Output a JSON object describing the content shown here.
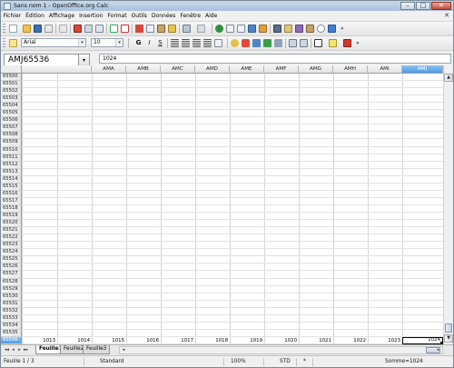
{
  "window": {
    "title": "Sans nom 1 - OpenOffice.org Calc"
  },
  "menu": {
    "items": [
      "Fichier",
      "Édition",
      "Affichage",
      "Insertion",
      "Format",
      "Outils",
      "Données",
      "Fenêtre",
      "Aide"
    ],
    "close_glyph": "✕"
  },
  "format_toolbar": {
    "font_name": "Arial",
    "font_size": "10",
    "bold": "G",
    "italic": "I",
    "underline": "S"
  },
  "formula_bar": {
    "name_box": "AMJ65536",
    "input_value": "1024"
  },
  "sheet": {
    "columns": [
      "AMA",
      "AMB",
      "AMC",
      "AMD",
      "AME",
      "AMF",
      "AMG",
      "AMH",
      "AMI",
      "AMJ"
    ],
    "active_column": "AMJ",
    "rows": [
      "65500",
      "65501",
      "65502",
      "65503",
      "65504",
      "65505",
      "65506",
      "65507",
      "65508",
      "65509",
      "65510",
      "65511",
      "65512",
      "65513",
      "65514",
      "65515",
      "65516",
      "65517",
      "65518",
      "65519",
      "65520",
      "65521",
      "65522",
      "65523",
      "65524",
      "65525",
      "65526",
      "65527",
      "65528",
      "65529",
      "65530",
      "65531",
      "65532",
      "65533",
      "65534",
      "65535",
      "65536"
    ],
    "active_row": "65536",
    "last_row_values": [
      "1013",
      "1014",
      "1015",
      "1016",
      "1017",
      "1018",
      "1019",
      "1020",
      "1021",
      "1022",
      "1023",
      "1024"
    ]
  },
  "tabs": {
    "nav": [
      "◂◂",
      "◂",
      "▸",
      "▸▸"
    ],
    "sheets": [
      "Feuille1",
      "Feuille2",
      "Feuille3"
    ],
    "active": "Feuille1"
  },
  "statusbar": {
    "sheet_info": "Feuille 1 / 3",
    "page_style": "Standard",
    "zoom": "100%",
    "mode": "STD",
    "modified_marker": "*",
    "sum": "Somme=1024"
  },
  "colors": {
    "selection_accent": "#4c9ae6",
    "titlebar": "#b5cbe4"
  }
}
